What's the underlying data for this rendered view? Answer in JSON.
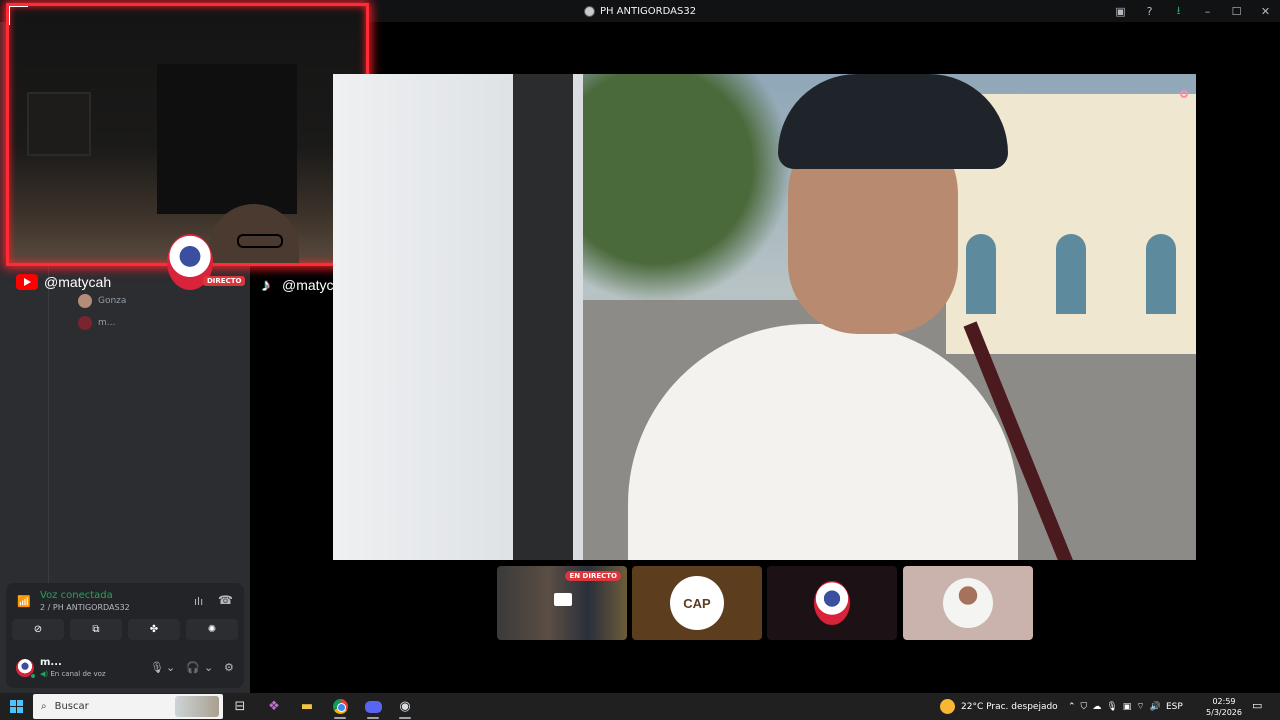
{
  "window": {
    "title": "PH ANTIGORDAS32",
    "icons": [
      "screen-share-icon",
      "help-icon",
      "download-icon",
      "minimize-icon",
      "maximize-icon",
      "close-icon"
    ]
  },
  "overlay": {
    "youtube_handle": "@matycah",
    "tiktok_handle": "@matycah",
    "live_label": "EN DIRECTO",
    "mini_live_label": "DIRECTO"
  },
  "members": [
    {
      "name": "Gonza"
    },
    {
      "name": "m..."
    }
  ],
  "tiles": [
    {
      "live_label": "EN DIRECTO"
    },
    {
      "logo_text": "CAP"
    }
  ],
  "voice": {
    "status": "Voz conectada",
    "channel": "2 / PH ANTIGORDAS32",
    "user_name": "m...",
    "user_status": "En canal de voz"
  },
  "taskbar": {
    "search_placeholder": "Buscar",
    "weather": "22°C  Prac. despejado",
    "language": "ESP",
    "time": "02:59",
    "date": "5/3/2026"
  }
}
